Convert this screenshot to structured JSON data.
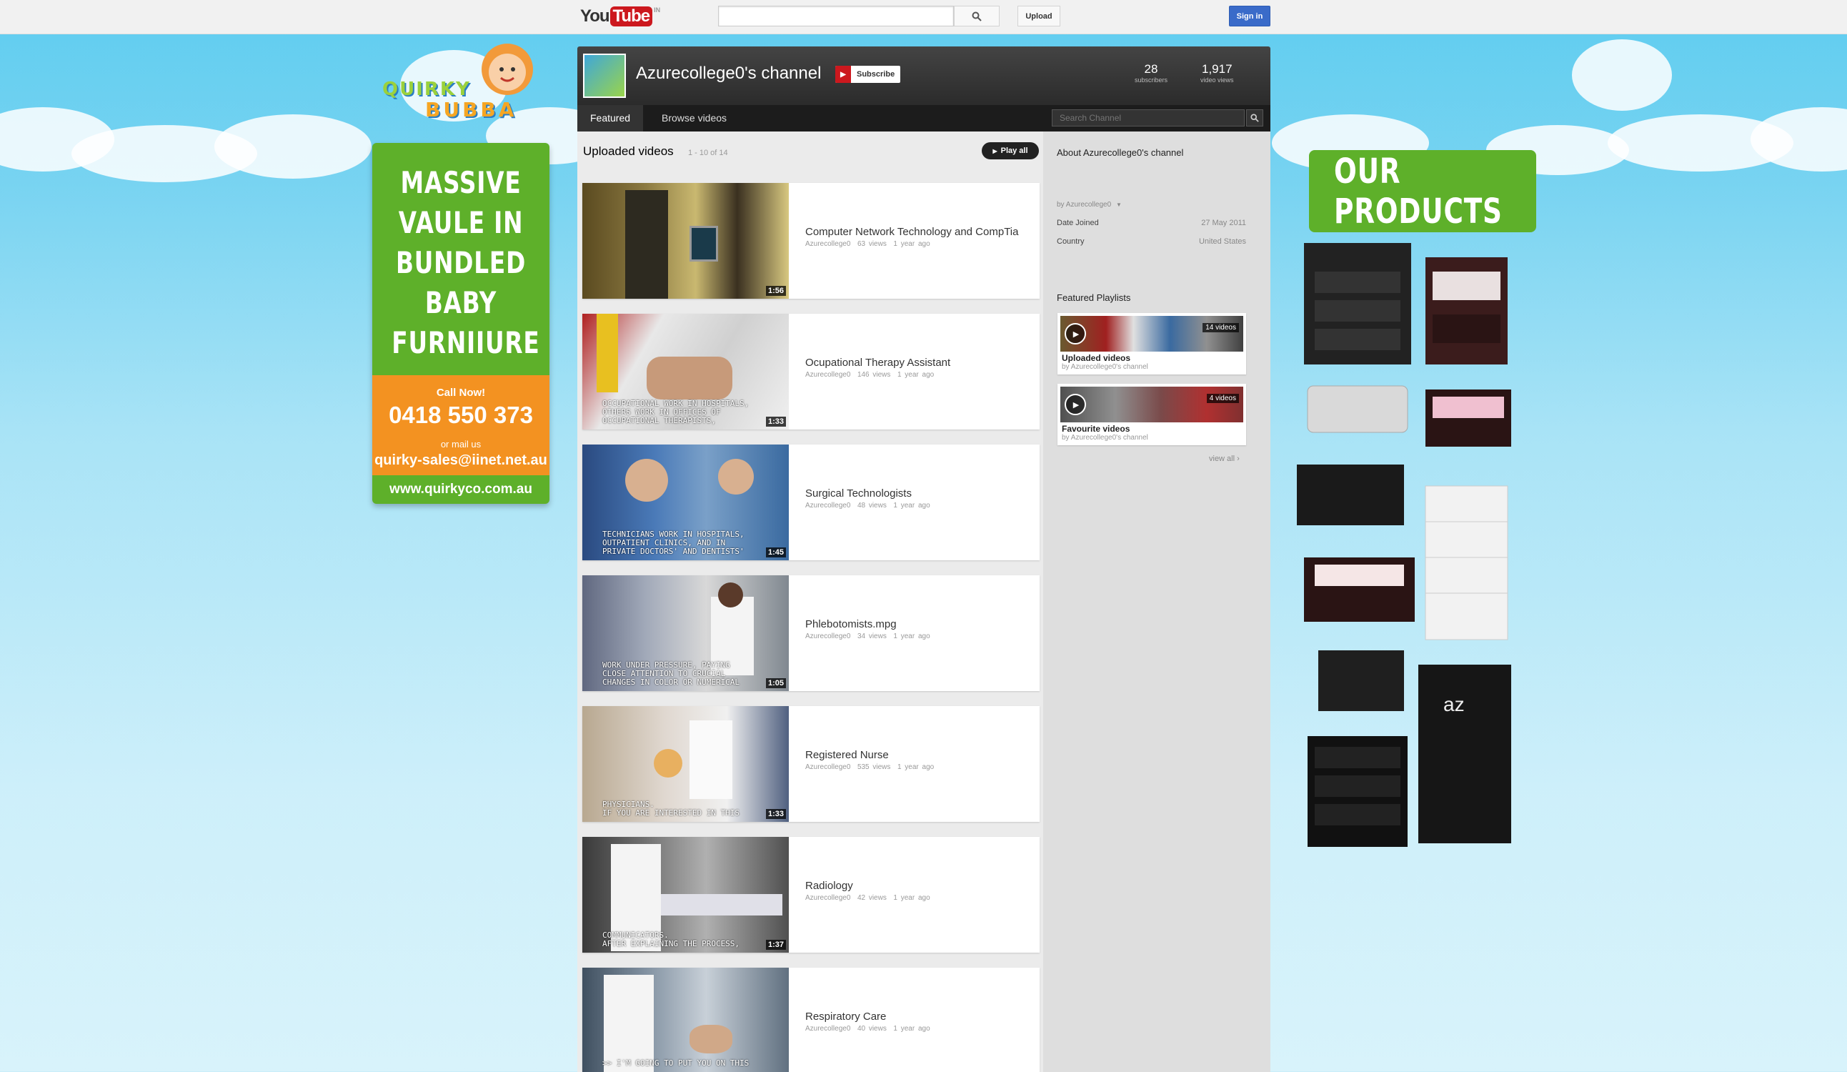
{
  "header": {
    "logo_you": "You",
    "logo_tube": "Tube",
    "logo_locale": "IN",
    "search_placeholder": "",
    "upload_label": "Upload",
    "signin_label": "Sign in"
  },
  "ad_left": {
    "headline_lines": [
      "MASSIVE",
      "VAULE IN",
      "BUNDLED",
      "BABY",
      "FURNIIURE"
    ],
    "call_label": "Call Now!",
    "phone": "0418 550 373",
    "mail_label": "or mail us",
    "email": "quirky-sales@iinet.net.au",
    "website": "www.quirkyco.com.au",
    "brand_line1": "QUIRKY",
    "brand_line2": "BUBBA"
  },
  "ad_right": {
    "title": "OUR PRODUCTS",
    "sign_text": "az"
  },
  "channel": {
    "title": "Azurecollege0's channel",
    "subscribe_label": "Subscribe",
    "subscribers_count": "28",
    "subscribers_label": "subscribers",
    "views_count": "1,917",
    "views_label": "video views",
    "tabs": [
      "Featured",
      "Browse videos"
    ],
    "search_placeholder": "Search Channel"
  },
  "uploads": {
    "title": "Uploaded videos",
    "range": "1 - 10 of 14",
    "play_all_label": "Play all",
    "videos": [
      {
        "title": "Computer Network Technology and CompTia",
        "uploader": "Azurecollege0",
        "views": "63 views",
        "age": "1 year ago",
        "duration": "1:56",
        "caption": ""
      },
      {
        "title": "Ocupational Therapy Assistant",
        "uploader": "Azurecollege0",
        "views": "146 views",
        "age": "1 year ago",
        "duration": "1:33",
        "caption": "OCCUPATIONAL WORK IN HOSPITALS,\nOTHERS WORK IN OFFICES OF\nOCCUPATIONAL THERAPISTS,"
      },
      {
        "title": "Surgical Technologists",
        "uploader": "Azurecollege0",
        "views": "48 views",
        "age": "1 year ago",
        "duration": "1:45",
        "caption": "TECHNICIANS WORK IN HOSPITALS,\nOUTPATIENT CLINICS, AND IN\nPRIVATE DOCTORS' AND DENTISTS'"
      },
      {
        "title": "Phlebotomists.mpg",
        "uploader": "Azurecollege0",
        "views": "34 views",
        "age": "1 year ago",
        "duration": "1:05",
        "caption": "WORK UNDER PRESSURE, PAYING\nCLOSE ATTENTION TO CRUCIAL\nCHANGES IN COLOR OR NUMERICAL"
      },
      {
        "title": "Registered Nurse",
        "uploader": "Azurecollege0",
        "views": "535 views",
        "age": "1 year ago",
        "duration": "1:33",
        "caption": "PHYSICIANS.\nIF YOU ARE INTERESTED IN THIS"
      },
      {
        "title": "Radiology",
        "uploader": "Azurecollege0",
        "views": "42 views",
        "age": "1 year ago",
        "duration": "1:37",
        "caption": "COMMUNICATORS.\nAFTER EXPLAINING THE PROCESS,"
      },
      {
        "title": "Respiratory Care",
        "uploader": "Azurecollege0",
        "views": "40 views",
        "age": "1 year ago",
        "duration": "",
        "caption": ">> I'M GOING TO PUT YOU ON THIS"
      }
    ]
  },
  "about": {
    "title": "About Azurecollege0's channel",
    "by_label": "by Azurecollege0",
    "rows": [
      {
        "key": "Date Joined",
        "value": "27 May 2011"
      },
      {
        "key": "Country",
        "value": "United States"
      }
    ]
  },
  "playlists": {
    "title": "Featured Playlists",
    "items": [
      {
        "name": "Uploaded videos",
        "by": "by Azurecollege0's channel",
        "count": "14 videos"
      },
      {
        "name": "Favourite videos",
        "by": "by Azurecollege0's channel",
        "count": "4 videos"
      }
    ],
    "view_all_label": "view all ›"
  },
  "colors": {
    "accent_green": "#5eb02a",
    "accent_orange": "#f39221",
    "youtube_red": "#cc181e",
    "signin_blue": "#3a6bc9"
  }
}
